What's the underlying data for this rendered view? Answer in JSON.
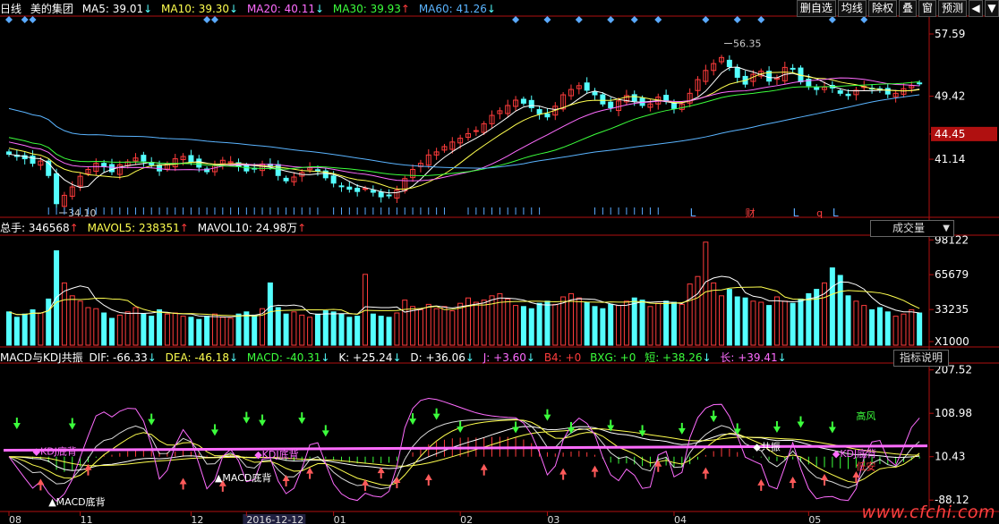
{
  "colors": {
    "up": "#ff3c3c",
    "down": "#54ffff",
    "ma5": "#ffffff",
    "ma10": "#ffff4f",
    "ma20": "#ff6cff",
    "ma30": "#3cff3c",
    "ma60": "#5ab4ff",
    "grid": "#7a1010",
    "axis": "#b01010",
    "label": "#ffffff",
    "highlight": "#b01010"
  },
  "header": {
    "period": "日线",
    "stock": "美的集团",
    "ma5": "MA5: 39.01",
    "ma10": "MA10: 39.30",
    "ma20": "MA20: 40.11",
    "ma30": "MA30: 39.93",
    "ma60": "MA60: 41.26"
  },
  "toolbar": {
    "items": [
      "删自选",
      "均线",
      "除权",
      "叠",
      "窗",
      "预测"
    ],
    "arrow_left": "◀",
    "arrow_down": "▼"
  },
  "vol_header": {
    "total": "总手: 346568",
    "mavol5": "MAVOL5: 238351",
    "mavol10": "MAVOL10: 24.98万"
  },
  "vol_dropdown": "成交量",
  "macd_header": {
    "name": "MACD与KDJ共振",
    "dif": "DIF: -66.33",
    "dea": "DEA: -46.18",
    "macd": "MACD: -40.31",
    "k": "K: +25.24",
    "d": "D: +36.06",
    "j": "J: +3.60",
    "b4": "B4: +0",
    "bxg": "BXG: +0",
    "short": "短: +38.26",
    "long": "长: +39.41"
  },
  "macd_button": "指标说明",
  "watermark": "www.cfchi.com",
  "x_labels": [
    "08",
    "11",
    "12",
    "2016-12-12",
    "01",
    "02",
    "03",
    "04",
    "05"
  ],
  "chart_data": [
    {
      "type": "candlestick",
      "name": "price",
      "ylim": [
        34.1,
        59
      ],
      "yticks": [
        "57.59",
        "49.42",
        "44.45",
        "41.14"
      ],
      "highlight_tick": "44.45",
      "annotations": [
        "56.35",
        "34.10",
        "财",
        "q",
        "L",
        "L",
        "L"
      ],
      "max_label": "56.35",
      "min_label": "34.10",
      "series": [
        {
          "name": "MA5",
          "value": "39.01"
        },
        {
          "name": "MA10",
          "value": "39.30"
        },
        {
          "name": "MA20",
          "value": "40.11"
        },
        {
          "name": "MA30",
          "value": "39.93"
        },
        {
          "name": "MA60",
          "value": "41.26"
        }
      ],
      "close": [
        41.8,
        41.5,
        41.2,
        40.6,
        40.9,
        39.0,
        35.3,
        36.4,
        37.5,
        38.9,
        39.8,
        40.6,
        40.2,
        39.5,
        40.4,
        40.8,
        41.3,
        40.9,
        40.4,
        39.6,
        40.5,
        41.2,
        41.5,
        40.8,
        40.1,
        39.5,
        40.3,
        41.0,
        40.8,
        40.2,
        39.6,
        39.9,
        40.5,
        40.2,
        39.0,
        38.3,
        38.8,
        39.4,
        40.0,
        39.6,
        38.7,
        38.0,
        37.6,
        37.2,
        36.9,
        37.3,
        36.8,
        36.2,
        36.4,
        37.1,
        38.6,
        39.8,
        40.6,
        41.7,
        42.1,
        42.8,
        43.4,
        43.9,
        44.5,
        44.9,
        45.8,
        46.9,
        47.5,
        48.2,
        48.9,
        48.5,
        47.9,
        47.1,
        46.7,
        48.1,
        49.6,
        50.3,
        50.8,
        50.2,
        49.6,
        48.4,
        47.9,
        48.8,
        49.5,
        48.8,
        48.2,
        48.4,
        49.3,
        48.8,
        47.8,
        48.4,
        49.8,
        51.6,
        52.8,
        53.7,
        54.5,
        53.3,
        51.9,
        51.0,
        52.3,
        52.7,
        51.4,
        51.8,
        53.2,
        53.0,
        51.3,
        50.8,
        50.3,
        50.6,
        50.5,
        49.8,
        49.5,
        50.2,
        50.7,
        50.4,
        50.2,
        49.7,
        49.8,
        50.4,
        50.8,
        51.1
      ],
      "volume": [
        31,
        26,
        29,
        33,
        30,
        43,
        88,
        58,
        46,
        41,
        35,
        34,
        30,
        25,
        28,
        31,
        35,
        29,
        27,
        33,
        29,
        30,
        27,
        26,
        24,
        27,
        29,
        26,
        25,
        29,
        31,
        28,
        34,
        58,
        35,
        29,
        31,
        28,
        26,
        29,
        32,
        31,
        29,
        26,
        27,
        66,
        29,
        27,
        26,
        30,
        42,
        36,
        33,
        38,
        34,
        36,
        32,
        39,
        44,
        40,
        42,
        46,
        48,
        43,
        37,
        36,
        34,
        39,
        41,
        38,
        45,
        48,
        44,
        40,
        36,
        34,
        38,
        37,
        41,
        44,
        42,
        36,
        39,
        41,
        40,
        38,
        57,
        64,
        96,
        58,
        46,
        52,
        45,
        44,
        41,
        40,
        37,
        45,
        41,
        39,
        43,
        48,
        52,
        58,
        72,
        65,
        46,
        41,
        37,
        33,
        35,
        31,
        27,
        29,
        33,
        30
      ]
    },
    {
      "type": "bar",
      "name": "volume",
      "yticks": [
        "98122",
        "65679",
        "33235",
        "X1000"
      ]
    },
    {
      "type": "line",
      "name": "MACD与KDJ共振",
      "yticks": [
        "207.52",
        "108.98",
        "10.43",
        "-88.12"
      ],
      "labels": {
        "macd_bottom": "MACD底背",
        "kdj_bottom": "KDJ底背",
        "gongzhen": "共振",
        "high_risk": "高风",
        "low_risk": "低安"
      },
      "series": [
        {
          "name": "DIF",
          "value": "-66.33"
        },
        {
          "name": "DEA",
          "value": "-46.18"
        },
        {
          "name": "MACD",
          "value": "-40.31"
        },
        {
          "name": "K",
          "value": "+25.24"
        },
        {
          "name": "D",
          "value": "+36.06"
        },
        {
          "name": "J",
          "value": "+3.60"
        }
      ]
    }
  ]
}
